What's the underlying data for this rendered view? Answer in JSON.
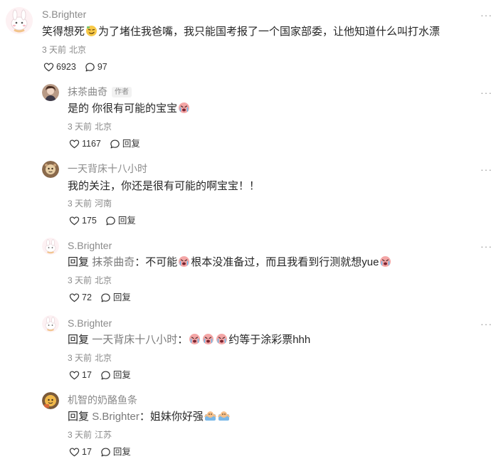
{
  "comments": [
    {
      "username": "S.Brighter",
      "text_before": "笑得想死",
      "text_after": "为了堵住我爸嘴，我只能国考报了一个国家部委，让他知道什么叫打水漂",
      "time": "3 天前",
      "location": "北京",
      "likes": "6923",
      "replies": "97"
    },
    {
      "username": "抹茶曲奇",
      "author_tag": "作者",
      "text": "是的 你很有可能的宝宝",
      "time": "3 天前",
      "location": "北京",
      "likes": "1167",
      "reply_label": "回复"
    },
    {
      "username": "一天背床十八小时",
      "text": "我的关注，你还是很有可能的啊宝宝！！",
      "time": "3 天前",
      "location": "河南",
      "likes": "175",
      "reply_label": "回复"
    },
    {
      "username": "S.Brighter",
      "reply_prefix": "回复",
      "reply_to": "抹茶曲奇",
      "text_before": "：不可能",
      "text_after": "根本没准备过，而且我看到行测就想yue",
      "time": "3 天前",
      "location": "北京",
      "likes": "72",
      "reply_label": "回复"
    },
    {
      "username": "S.Brighter",
      "reply_prefix": "回复",
      "reply_to": "一天背床十八小时",
      "text_before": "：",
      "text_after": "约等于涂彩票hhh",
      "time": "3 天前",
      "location": "北京",
      "likes": "17",
      "reply_label": "回复"
    },
    {
      "username": "机智的奶酪鱼条",
      "reply_prefix": "回复",
      "reply_to": "S.Brighter",
      "text_before": "：姐妹你好强",
      "time": "3 天前",
      "location": "江苏",
      "likes": "17",
      "reply_label": "回复"
    }
  ],
  "more_label": "···",
  "icons": {
    "like": "heart-outline-icon",
    "reply": "speech-bubble-icon",
    "emoji_smirk": "smirk-emoji-icon",
    "emoji_cry": "crying-face-emoji-icon",
    "emoji_strong": "flexing-emoji-icon"
  }
}
